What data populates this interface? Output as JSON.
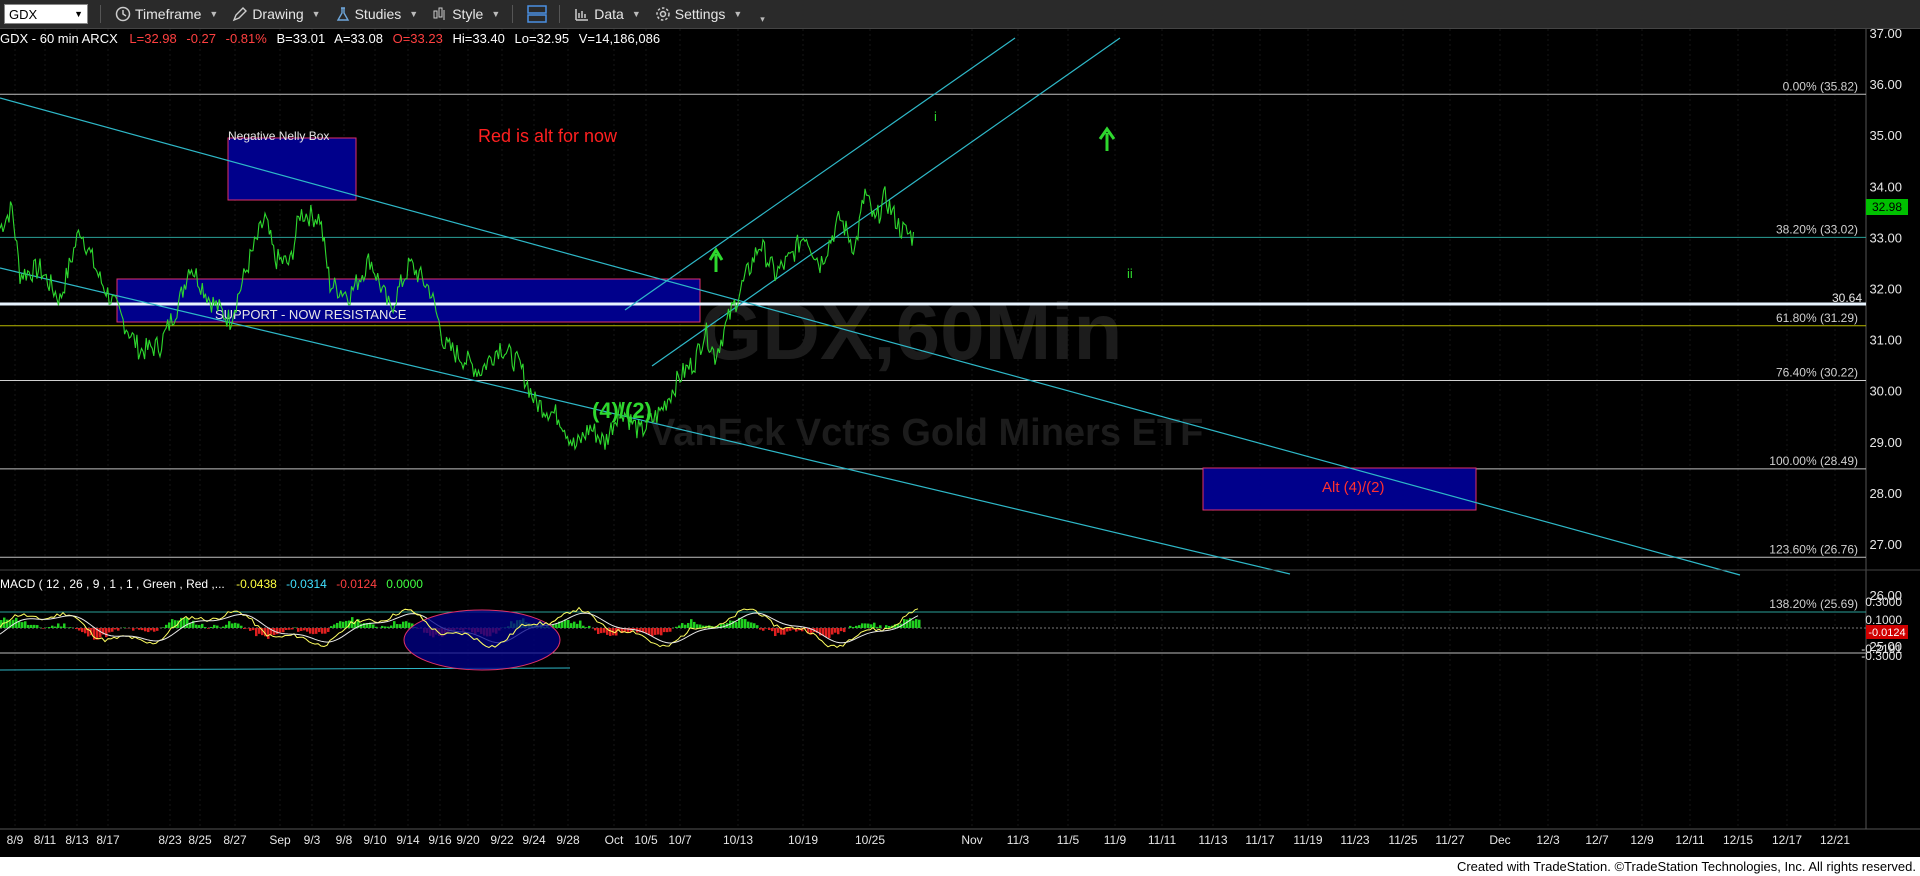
{
  "toolbar": {
    "symbol": "GDX",
    "items": [
      {
        "label": "Timeframe",
        "icon": "clock-icon"
      },
      {
        "label": "Drawing",
        "icon": "pencil-icon"
      },
      {
        "label": "Studies",
        "icon": "flask-icon"
      },
      {
        "label": "Style",
        "icon": "chart-style-icon"
      },
      {
        "label": "Data",
        "icon": "data-bars-icon"
      },
      {
        "label": "Settings",
        "icon": "gear-icon"
      }
    ]
  },
  "header": {
    "title": "GDX - 60 min  ARCX",
    "last": "L=32.98",
    "change": "-0.27",
    "change_pct": "-0.81%",
    "bid": "B=33.01",
    "ask": "A=33.08",
    "open": "O=33.23",
    "high": "Hi=33.40",
    "low": "Lo=32.95",
    "volume": "V=14,186,086"
  },
  "watermark": {
    "symbol": "GDX,60Min",
    "name": "VanEck Vctrs Gold Miners ETF"
  },
  "price_axis": {
    "labels": [
      "37.00",
      "36.00",
      "35.00",
      "34.00",
      "33.00",
      "32.00",
      "31.00",
      "30.00",
      "29.00",
      "28.00",
      "27.00",
      "26.00",
      "25.00"
    ],
    "current_price": "32.98",
    "current_color": "#00c000"
  },
  "fib_levels": [
    {
      "label": "0.00% (35.82)",
      "price": 35.82,
      "color": "#bfbfbf"
    },
    {
      "label": "38.20% (33.02)",
      "price": 33.02,
      "color": "#2aa198"
    },
    {
      "label": "61.80% (31.29)",
      "price": 31.29,
      "color": "#b8b800"
    },
    {
      "label": "76.40% (30.22)",
      "price": 30.22,
      "color": "#d0d0d0"
    },
    {
      "label": "100.00% (28.49)",
      "price": 28.49,
      "color": "#bfbfbf"
    },
    {
      "label": "123.60% (26.76)",
      "price": 26.76,
      "color": "#bfbfbf"
    },
    {
      "label": "138.20% (25.69)",
      "price": 25.69,
      "color": "#2aa198"
    }
  ],
  "support_line": {
    "label": "30.64",
    "price": 30.64
  },
  "annotations": {
    "negative_box": "Negative Nelly Box",
    "red_alt": "Red is alt for now",
    "support_box": "SUPPORT -  NOW RESISTANCE",
    "wave_label": "(4)/(2)",
    "alt_box": "Alt (4)/(2)",
    "wave_i": "i",
    "wave_ii": "ii"
  },
  "macd": {
    "label": "MACD ( 12 , 26 , 9 , 1 , 1 , Green , Red ,...",
    "v1": "-0.0438",
    "v2": "-0.0314",
    "v3": "-0.0124",
    "v4": "0.0000",
    "axis_labels": [
      "0.3000",
      "0.1000",
      "-0.2191",
      "-0.3000"
    ],
    "current": "-0.0124"
  },
  "x_axis": {
    "labels": [
      "8/9",
      "8/11",
      "8/13",
      "8/17",
      "8/23",
      "8/25",
      "8/27",
      "Sep",
      "9/3",
      "9/8",
      "9/10",
      "9/14",
      "9/16",
      "9/20",
      "9/22",
      "9/24",
      "9/28",
      "Oct",
      "10/5",
      "10/7",
      "10/13",
      "10/19",
      "10/25",
      "Nov",
      "11/3",
      "11/5",
      "11/9",
      "11/11",
      "11/13",
      "11/17",
      "11/19",
      "11/23",
      "11/25",
      "11/27",
      "Dec",
      "12/3",
      "12/7",
      "12/9",
      "12/11",
      "12/15",
      "12/17",
      "12/21"
    ]
  },
  "footer": {
    "text": "Created with TradeStation. ©TradeStation Technologies, Inc. All rights reserved."
  }
}
